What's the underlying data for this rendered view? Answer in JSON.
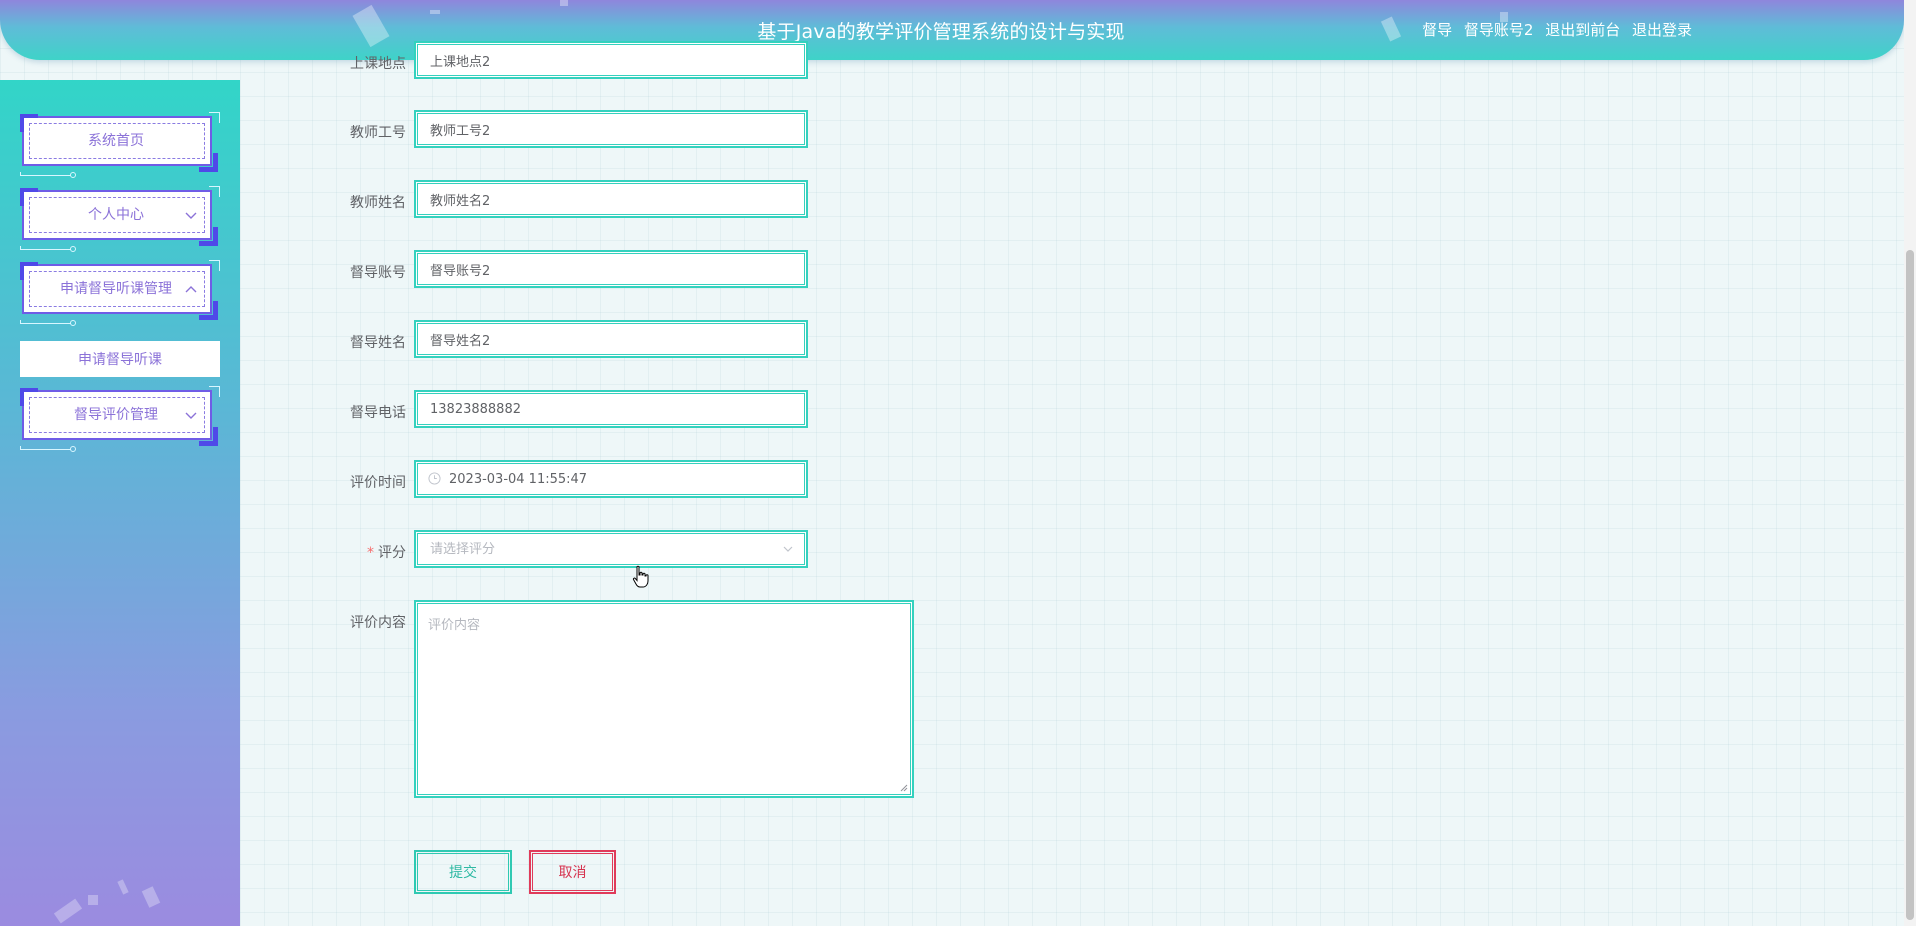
{
  "header": {
    "title": "基于Java的教学评价管理系统的设计与实现",
    "role": "督导",
    "username": "督导账号2",
    "front_link": "退出到前台",
    "logout_link": "退出登录"
  },
  "sidebar": {
    "items": [
      {
        "label": "系统首页"
      },
      {
        "label": "个人中心"
      },
      {
        "label": "申请督导听课管理"
      },
      {
        "label": "督导评价管理"
      }
    ],
    "submenu": {
      "label": "申请督导听课"
    }
  },
  "form": {
    "location": {
      "label": "上课地点",
      "value": "上课地点2"
    },
    "teacher_id": {
      "label": "教师工号",
      "value": "教师工号2"
    },
    "teacher_name": {
      "label": "教师姓名",
      "value": "教师姓名2"
    },
    "supervisor_account": {
      "label": "督导账号",
      "value": "督导账号2"
    },
    "supervisor_name": {
      "label": "督导姓名",
      "value": "督导姓名2"
    },
    "supervisor_phone": {
      "label": "督导电话",
      "value": "13823888882"
    },
    "eval_time": {
      "label": "评价时间",
      "value": "2023-03-04 11:55:47"
    },
    "score": {
      "required_mark": "*",
      "label": "评分",
      "placeholder": "请选择评分"
    },
    "content": {
      "label": "评价内容",
      "placeholder": "评价内容"
    },
    "submit_label": "提交",
    "cancel_label": "取消"
  }
}
